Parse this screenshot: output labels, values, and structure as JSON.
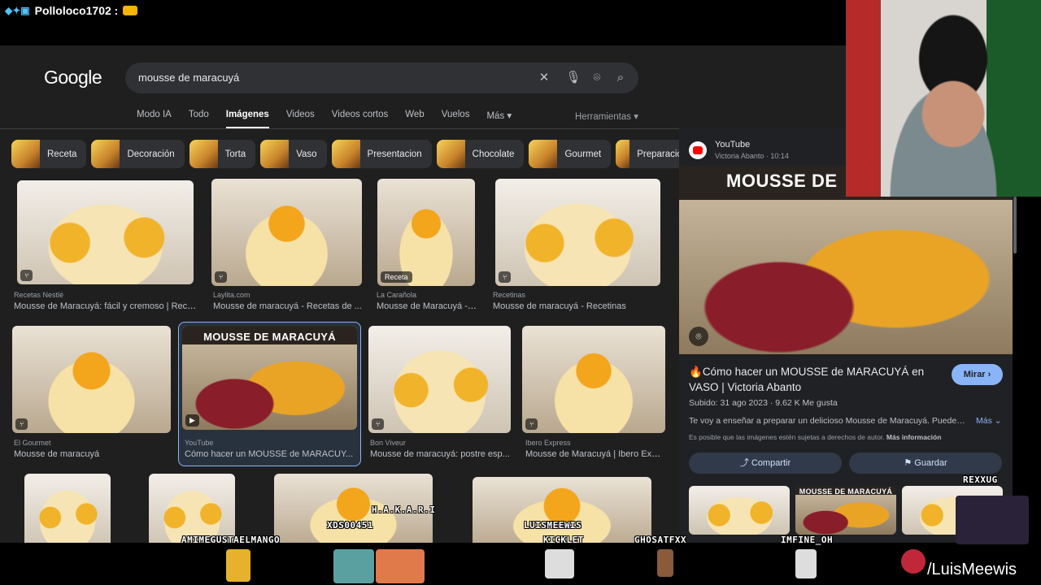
{
  "stream": {
    "chat_user": "Polloloco1702 :",
    "overlay_names": [
      "AMIMEGUSTAELMANGO",
      "XDS00451",
      "H.A.K.A.R.I",
      "LUISMEEWIS",
      "KICKLET",
      "GHOSATFXX",
      "IMFINE_OH",
      "REXXUG"
    ],
    "brand_text": "/LuisMeewis"
  },
  "search": {
    "logo": "Google",
    "query": "mousse de maracuyá"
  },
  "tabs": [
    "Modo IA",
    "Todo",
    "Imágenes",
    "Videos",
    "Videos cortos",
    "Web",
    "Vuelos",
    "Más ▾"
  ],
  "tools_label": "Herramientas ▾",
  "chips": [
    "Receta",
    "Decoración",
    "Torta",
    "Vaso",
    "Presentacion",
    "Chocolate",
    "Gourmet",
    "Preparación"
  ],
  "results": [
    {
      "source": "Recetas Nestlé",
      "title": "Mousse de Maracuyá: fácil y cremoso | Recet..."
    },
    {
      "source": "Laylita.com",
      "title": "Mousse de maracuyá - Recetas de ..."
    },
    {
      "source": "La Carañola",
      "title": "Mousse de Maracuyá - ...",
      "tag": "Receta"
    },
    {
      "source": "Recetinas",
      "title": "Mousse de maracuyá - Recetinas"
    },
    {
      "source": "El Gourmet",
      "title": "Mousse de maracuyá"
    },
    {
      "source": "YouTube",
      "title": "Cómo hacer un MOUSSE de MARACUY...",
      "overlay": "MOUSSE DE MARACUYÁ"
    },
    {
      "source": "Bon Viveur",
      "title": "Mousse de maracuyá: postre esp..."
    },
    {
      "source": "Ibero Express",
      "title": "Mousse de Maracuyá | Ibero Expr..."
    }
  ],
  "panel": {
    "site": "YouTube",
    "author": "Victoria Abanto · 10:14",
    "hero_text": "MOUSSE DE",
    "title": "Cómo hacer un MOUSSE de MARACUYÁ en VASO | Victoria Abanto",
    "mirar": "Mirar ›",
    "meta": "Subido: 31 ago 2023 · 9.62 K Me gusta",
    "description": "Te voy a enseñar a preparar un delicioso Mousse de Maracuyá. Puedes...",
    "more": "Más ⌄",
    "legal": "Es posible que las imágenes estén sujetas a derechos de autor.",
    "legal_link": "Más información",
    "share": "Compartir",
    "save": "Guardar",
    "related_overlay": "MOUSSE DE MARACUYÁ"
  }
}
